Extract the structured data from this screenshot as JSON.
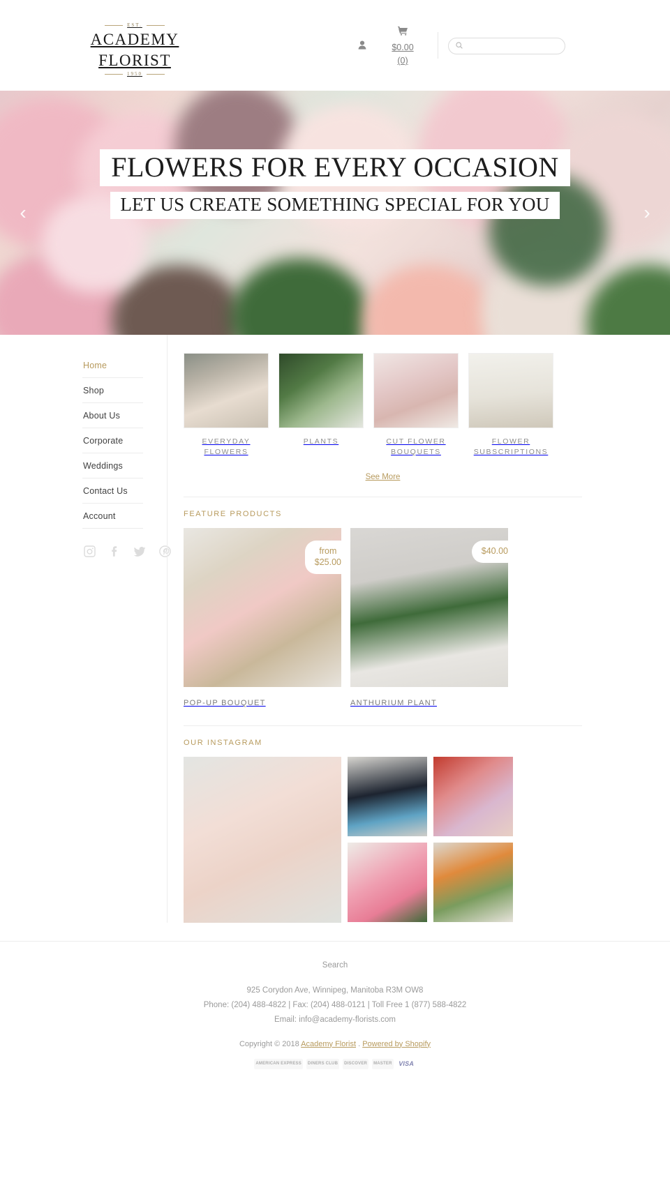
{
  "header": {
    "logo": {
      "est_top": "EST.",
      "name_line1": "ACADEMY",
      "name_line2": "FLORIST",
      "year": "1950"
    },
    "account_icon": "user-icon",
    "cart": {
      "icon": "cart-icon",
      "amount": "$0.00",
      "count": "(0)"
    },
    "search": {
      "icon": "search-icon",
      "placeholder": "",
      "value": ""
    }
  },
  "hero": {
    "title": "FLOWERS FOR EVERY OCCASION",
    "subtitle": "LET US CREATE SOMETHING SPECIAL FOR YOU",
    "prev_arrow": "‹",
    "next_arrow": "›"
  },
  "sidebar": {
    "items": [
      {
        "label": "Home",
        "active": true
      },
      {
        "label": "Shop",
        "active": false
      },
      {
        "label": "About Us",
        "active": false
      },
      {
        "label": "Corporate",
        "active": false
      },
      {
        "label": "Weddings",
        "active": false
      },
      {
        "label": "Contact Us",
        "active": false
      },
      {
        "label": "Account",
        "active": false
      }
    ],
    "socials": [
      "instagram-icon",
      "facebook-icon",
      "twitter-icon",
      "pinterest-icon"
    ]
  },
  "categories": {
    "items": [
      {
        "label": "EVERYDAY FLOWERS"
      },
      {
        "label": "PLANTS"
      },
      {
        "label": "CUT FLOWER BOUQUETS"
      },
      {
        "label": "FLOWER SUBSCRIPTIONS"
      }
    ],
    "see_more": "See More"
  },
  "features": {
    "title": "FEATURE PRODUCTS",
    "items": [
      {
        "name": "POP-UP BOUQUET",
        "price_prefix": "from",
        "price": "$25.00"
      },
      {
        "name": "ANTHURIUM PLANT",
        "price_prefix": "",
        "price": "$40.00"
      }
    ]
  },
  "instagram": {
    "title": "OUR INSTAGRAM"
  },
  "footer": {
    "search_link": "Search",
    "address": "925 Corydon Ave, Winnipeg, Manitoba R3M OW8",
    "phone_line": "Phone: (204) 488-4822 | Fax: (204) 488-0121 | Toll Free 1 (877) 588-4822",
    "email_line": "Email: info@academy-florists.com",
    "copyright_prefix": "Copyright © 2018",
    "copyright_link": "Academy Florist",
    "copyright_sep": ".",
    "powered_by": "Powered by Shopify",
    "payments": [
      "AMERICAN EXPRESS",
      "DINERS CLUB",
      "DISCOVER",
      "MASTER",
      "VISA"
    ]
  },
  "colors": {
    "accent": "#b79a5d",
    "text": "#555555",
    "muted": "#9a9a9a"
  }
}
